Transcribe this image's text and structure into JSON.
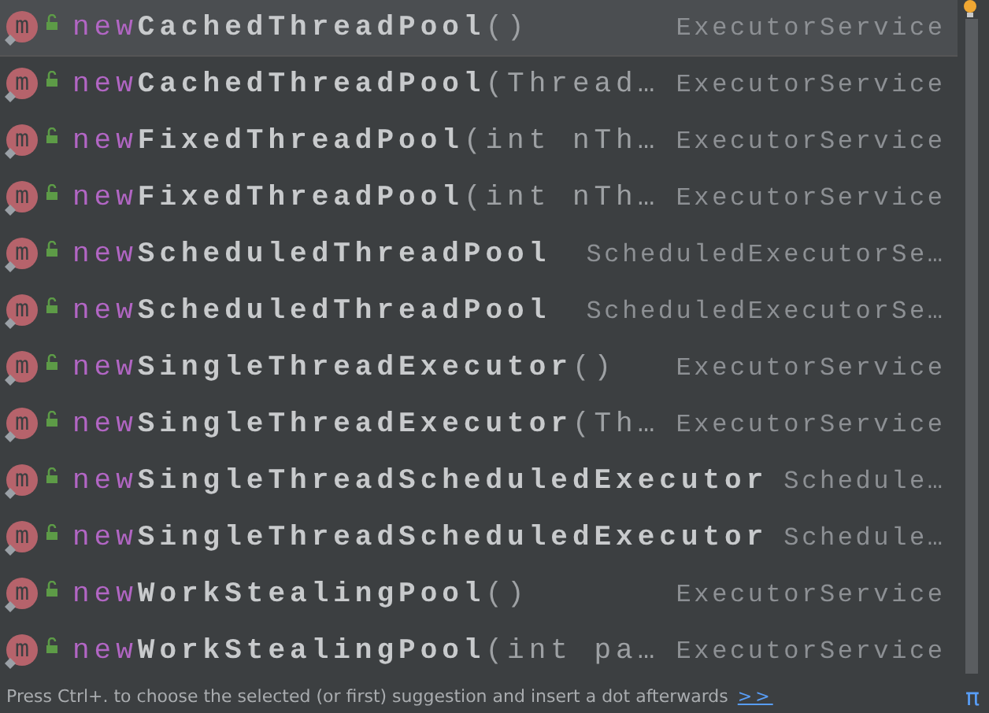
{
  "suggestions": [
    {
      "icon": "m",
      "prefix": "new",
      "name": "CachedThreadPool",
      "tail": "()",
      "type": "ExecutorService",
      "selected": true
    },
    {
      "icon": "m",
      "prefix": "new",
      "name": "CachedThreadPool",
      "tail": "(Thread…",
      "type": "ExecutorService",
      "selected": false
    },
    {
      "icon": "m",
      "prefix": "new",
      "name": "FixedThreadPool",
      "tail": "(int nTh…",
      "type": "ExecutorService",
      "selected": false
    },
    {
      "icon": "m",
      "prefix": "new",
      "name": "FixedThreadPool",
      "tail": "(int nTh…",
      "type": "ExecutorService",
      "selected": false
    },
    {
      "icon": "m",
      "prefix": "new",
      "name": "ScheduledThreadPool",
      "type": "ScheduledExecutorSe…",
      "selected": false
    },
    {
      "icon": "m",
      "prefix": "new",
      "name": "ScheduledThreadPool",
      "type": "ScheduledExecutorSe…",
      "selected": false
    },
    {
      "icon": "m",
      "prefix": "new",
      "name": "SingleThreadExecutor",
      "tail": "()",
      "type": "ExecutorService",
      "selected": false
    },
    {
      "icon": "m",
      "prefix": "new",
      "name": "SingleThreadExecutor",
      "tail": "(Th…",
      "type": "ExecutorService",
      "selected": false
    },
    {
      "icon": "m",
      "prefix": "new",
      "name": "SingleThreadScheduledExecutor",
      "type": "Schedule…",
      "selected": false
    },
    {
      "icon": "m",
      "prefix": "new",
      "name": "SingleThreadScheduledExecutor",
      "type": "Schedule…",
      "selected": false
    },
    {
      "icon": "m",
      "prefix": "new",
      "name": "WorkStealingPool",
      "tail": "()",
      "type": "ExecutorService",
      "selected": false
    },
    {
      "icon": "m",
      "prefix": "new",
      "name": "WorkStealingPool",
      "tail": "(int pa…",
      "type": "ExecutorService",
      "selected": false
    }
  ],
  "footer": {
    "hint": "Press Ctrl+. to choose the selected (or first) suggestion and insert a dot afterwards",
    "link": ">>",
    "pi": "π"
  }
}
